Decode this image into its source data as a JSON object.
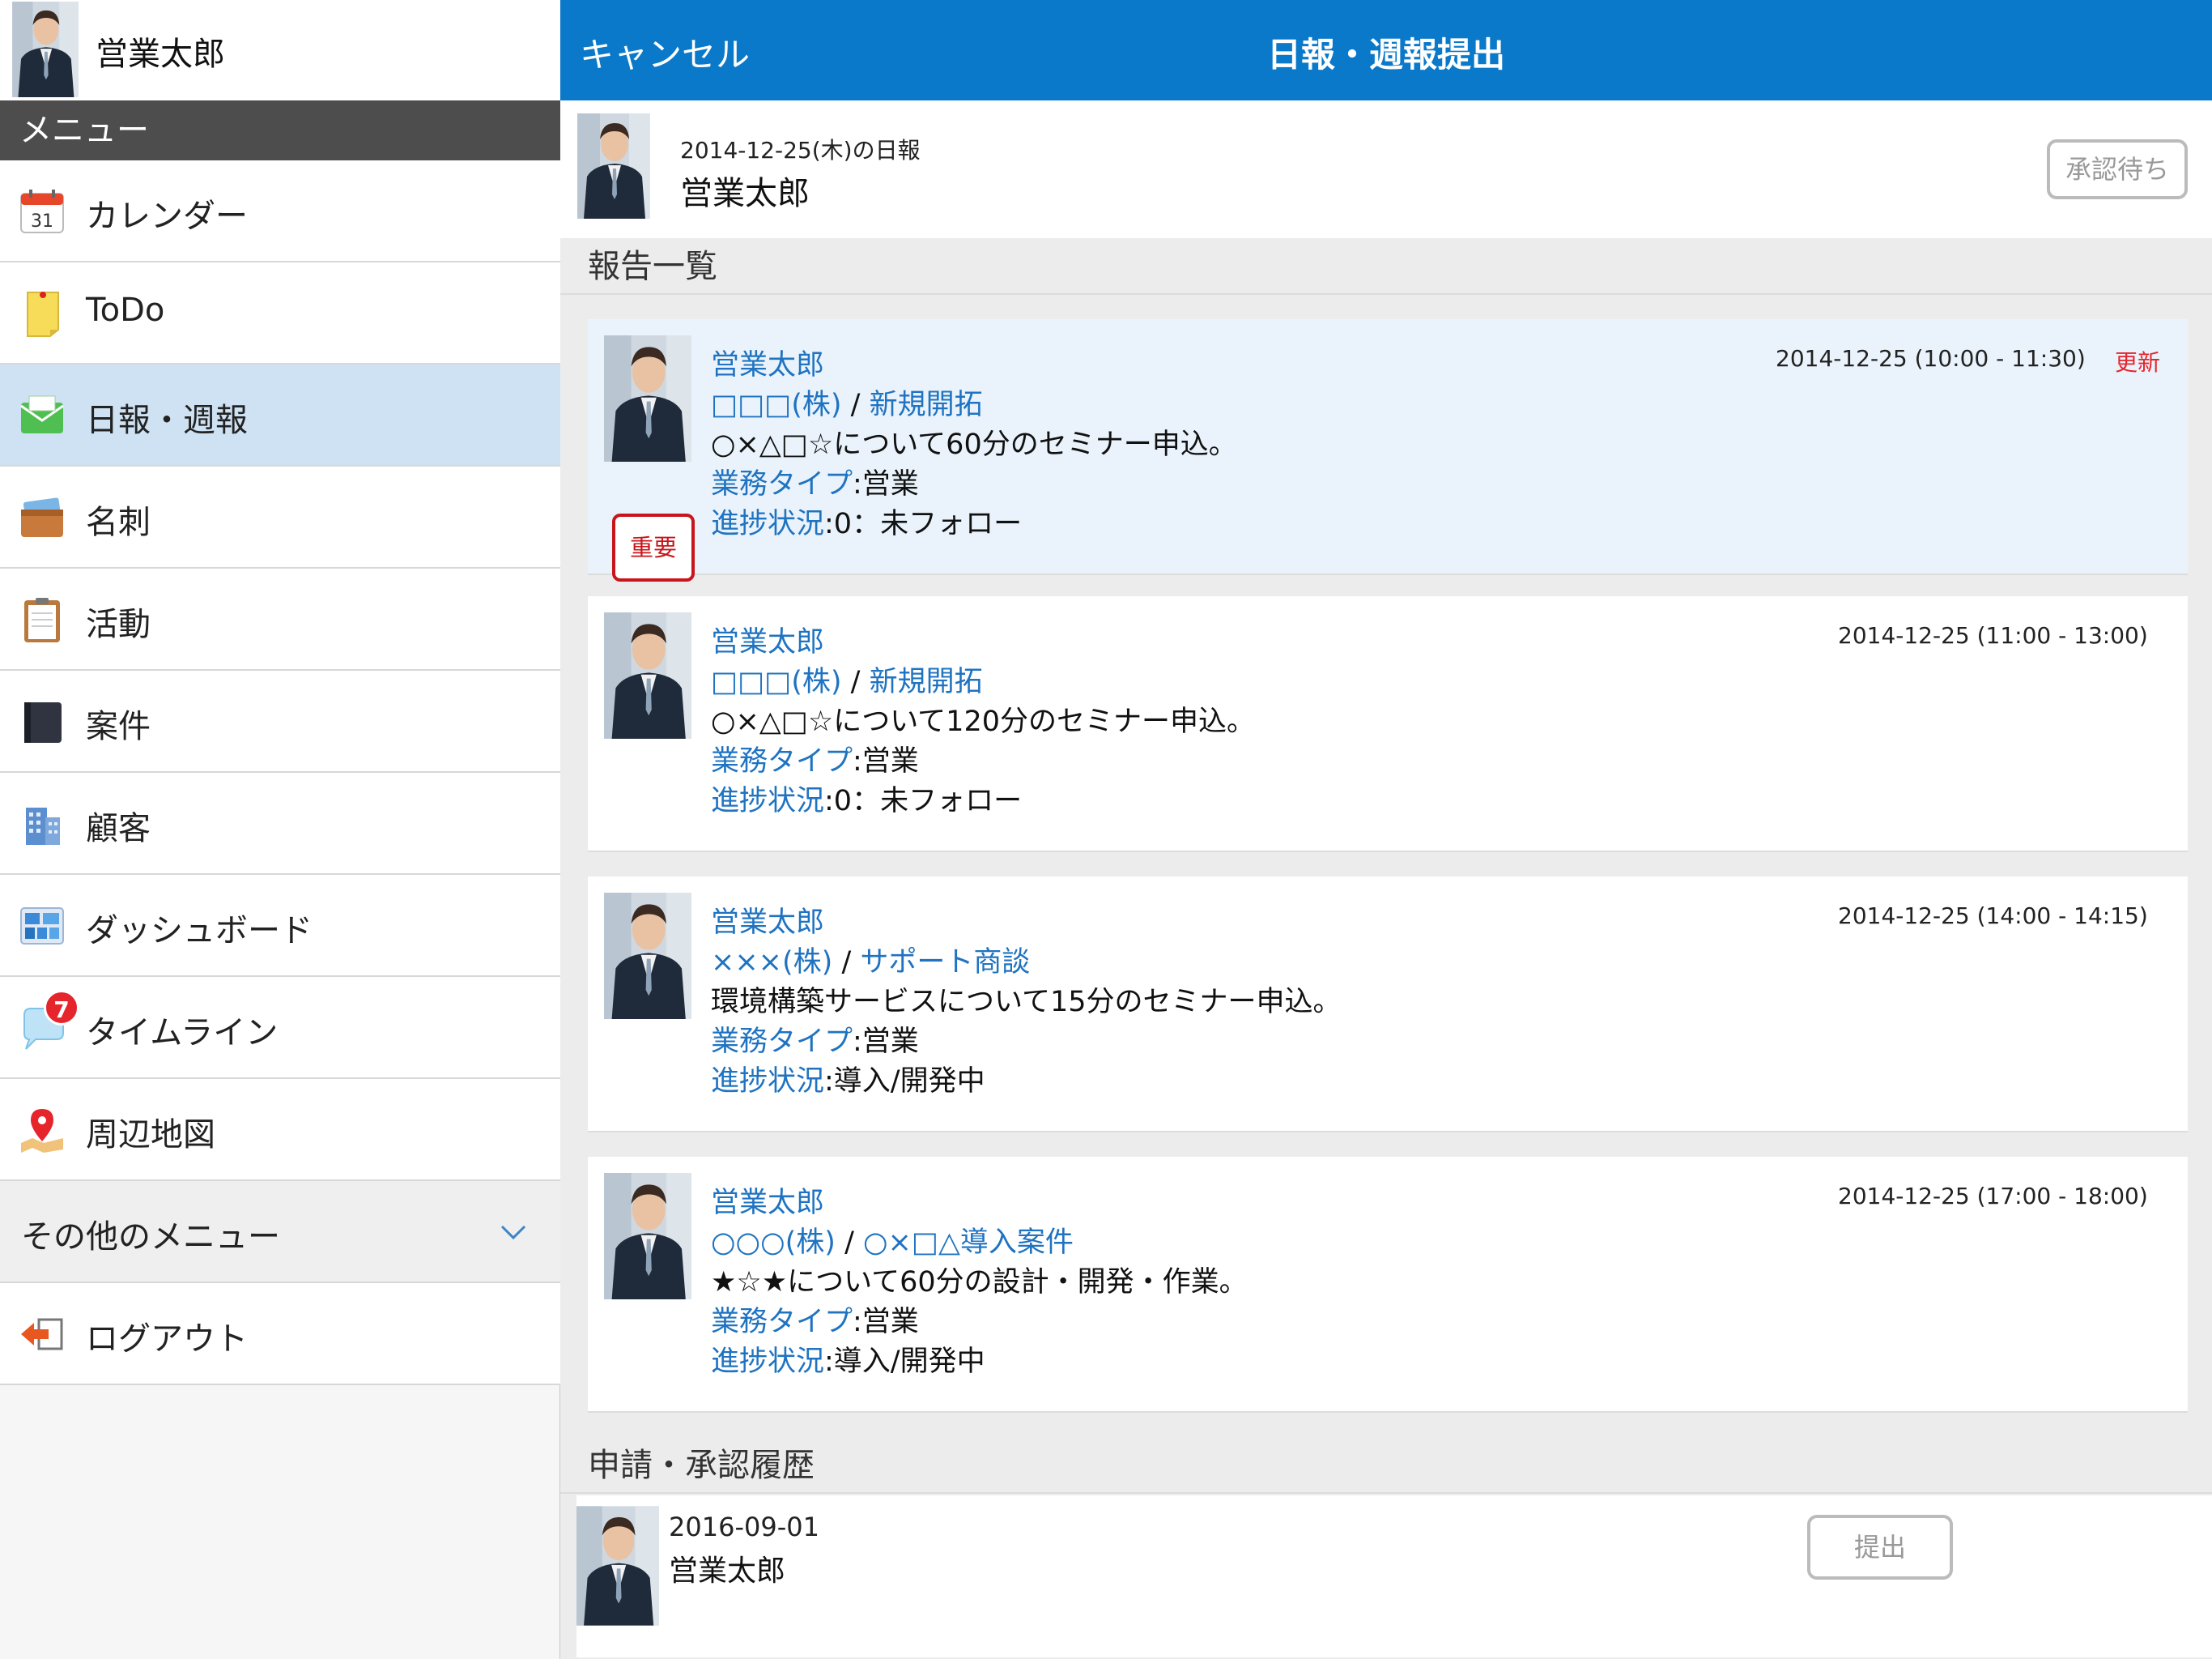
{
  "sidebar": {
    "user_name": "営業太郎",
    "menu_header": "メニュー",
    "items": [
      {
        "label": "カレンダー",
        "icon": "calendar-icon",
        "icon_text": "31"
      },
      {
        "label": "ToDo",
        "icon": "todo-note-icon"
      },
      {
        "label": "日報・週報",
        "icon": "report-envelope-icon"
      },
      {
        "label": "名刺",
        "icon": "business-card-icon"
      },
      {
        "label": "活動",
        "icon": "clipboard-icon"
      },
      {
        "label": "案件",
        "icon": "notebook-icon"
      },
      {
        "label": "顧客",
        "icon": "building-icon"
      },
      {
        "label": "ダッシュボード",
        "icon": "dashboard-icon"
      },
      {
        "label": "タイムライン",
        "icon": "chat-bubble-icon",
        "badge": "7"
      },
      {
        "label": "周辺地図",
        "icon": "map-pin-icon"
      }
    ],
    "other_menu": "その他のメニュー",
    "logout": "ログアウト"
  },
  "header": {
    "cancel": "キャンセル",
    "title": "日報・週報提出"
  },
  "report": {
    "date_label": "2014-12-25(木)の日報",
    "user_name": "営業太郎",
    "status_button": "承認待ち"
  },
  "reports_section_title": "報告一覧",
  "reports": [
    {
      "name": "営業太郎",
      "company": "□□□(株)",
      "separator": "/",
      "project": "新規開拓",
      "description": "○×△□☆について60分のセミナー申込。",
      "type_label": "業務タイプ",
      "type_value": ":営業",
      "progress_label": "進捗状況",
      "progress_value": ":0：未フォロー",
      "time": "2014-12-25 (10:00 - 11:30)",
      "update": "更新",
      "important": "重要"
    },
    {
      "name": "営業太郎",
      "company": "□□□(株)",
      "separator": "/",
      "project": "新規開拓",
      "description": "○×△□☆について120分のセミナー申込。",
      "type_label": "業務タイプ",
      "type_value": ":営業",
      "progress_label": "進捗状況",
      "progress_value": ":0：未フォロー",
      "time": "2014-12-25 (11:00 - 13:00)"
    },
    {
      "name": "営業太郎",
      "company": "×××(株)",
      "separator": "/",
      "project": "サポート商談",
      "description": "環境構築サービスについて15分のセミナー申込。",
      "type_label": "業務タイプ",
      "type_value": ":営業",
      "progress_label": "進捗状況",
      "progress_value": ":導入/開発中",
      "time": "2014-12-25 (14:00 - 14:15)"
    },
    {
      "name": "営業太郎",
      "company": "○○○(株)",
      "separator": "/",
      "project": "○×□△導入案件",
      "description": "★☆★について60分の設計・開発・作業。",
      "type_label": "業務タイプ",
      "type_value": ":営業",
      "progress_label": "進捗状況",
      "progress_value": ":導入/開発中",
      "time": "2014-12-25 (17:00 - 18:00)"
    }
  ],
  "history_section_title": "申請・承認履歴",
  "history": {
    "date": "2016-09-01",
    "user_name": "営業太郎",
    "submit_button": "提出"
  },
  "colors": {
    "header_blue": "#0a79c9",
    "link_blue": "#1f73c1",
    "active_row": "#cfe2f3",
    "highlight_card": "#eaf3fb",
    "alert_red": "#e5242b"
  }
}
